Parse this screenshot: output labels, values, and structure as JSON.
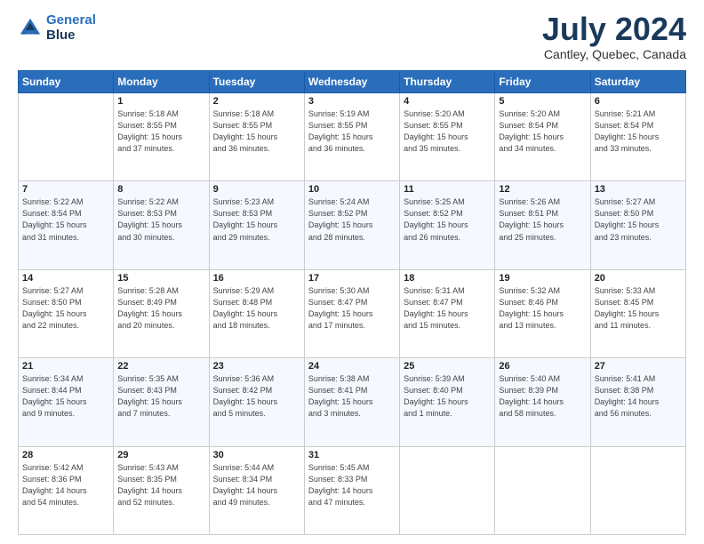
{
  "header": {
    "logo_line1": "General",
    "logo_line2": "Blue",
    "month": "July 2024",
    "location": "Cantley, Quebec, Canada"
  },
  "weekdays": [
    "Sunday",
    "Monday",
    "Tuesday",
    "Wednesday",
    "Thursday",
    "Friday",
    "Saturday"
  ],
  "weeks": [
    [
      {
        "day": "",
        "info": ""
      },
      {
        "day": "1",
        "info": "Sunrise: 5:18 AM\nSunset: 8:55 PM\nDaylight: 15 hours\nand 37 minutes."
      },
      {
        "day": "2",
        "info": "Sunrise: 5:18 AM\nSunset: 8:55 PM\nDaylight: 15 hours\nand 36 minutes."
      },
      {
        "day": "3",
        "info": "Sunrise: 5:19 AM\nSunset: 8:55 PM\nDaylight: 15 hours\nand 36 minutes."
      },
      {
        "day": "4",
        "info": "Sunrise: 5:20 AM\nSunset: 8:55 PM\nDaylight: 15 hours\nand 35 minutes."
      },
      {
        "day": "5",
        "info": "Sunrise: 5:20 AM\nSunset: 8:54 PM\nDaylight: 15 hours\nand 34 minutes."
      },
      {
        "day": "6",
        "info": "Sunrise: 5:21 AM\nSunset: 8:54 PM\nDaylight: 15 hours\nand 33 minutes."
      }
    ],
    [
      {
        "day": "7",
        "info": "Sunrise: 5:22 AM\nSunset: 8:54 PM\nDaylight: 15 hours\nand 31 minutes."
      },
      {
        "day": "8",
        "info": "Sunrise: 5:22 AM\nSunset: 8:53 PM\nDaylight: 15 hours\nand 30 minutes."
      },
      {
        "day": "9",
        "info": "Sunrise: 5:23 AM\nSunset: 8:53 PM\nDaylight: 15 hours\nand 29 minutes."
      },
      {
        "day": "10",
        "info": "Sunrise: 5:24 AM\nSunset: 8:52 PM\nDaylight: 15 hours\nand 28 minutes."
      },
      {
        "day": "11",
        "info": "Sunrise: 5:25 AM\nSunset: 8:52 PM\nDaylight: 15 hours\nand 26 minutes."
      },
      {
        "day": "12",
        "info": "Sunrise: 5:26 AM\nSunset: 8:51 PM\nDaylight: 15 hours\nand 25 minutes."
      },
      {
        "day": "13",
        "info": "Sunrise: 5:27 AM\nSunset: 8:50 PM\nDaylight: 15 hours\nand 23 minutes."
      }
    ],
    [
      {
        "day": "14",
        "info": "Sunrise: 5:27 AM\nSunset: 8:50 PM\nDaylight: 15 hours\nand 22 minutes."
      },
      {
        "day": "15",
        "info": "Sunrise: 5:28 AM\nSunset: 8:49 PM\nDaylight: 15 hours\nand 20 minutes."
      },
      {
        "day": "16",
        "info": "Sunrise: 5:29 AM\nSunset: 8:48 PM\nDaylight: 15 hours\nand 18 minutes."
      },
      {
        "day": "17",
        "info": "Sunrise: 5:30 AM\nSunset: 8:47 PM\nDaylight: 15 hours\nand 17 minutes."
      },
      {
        "day": "18",
        "info": "Sunrise: 5:31 AM\nSunset: 8:47 PM\nDaylight: 15 hours\nand 15 minutes."
      },
      {
        "day": "19",
        "info": "Sunrise: 5:32 AM\nSunset: 8:46 PM\nDaylight: 15 hours\nand 13 minutes."
      },
      {
        "day": "20",
        "info": "Sunrise: 5:33 AM\nSunset: 8:45 PM\nDaylight: 15 hours\nand 11 minutes."
      }
    ],
    [
      {
        "day": "21",
        "info": "Sunrise: 5:34 AM\nSunset: 8:44 PM\nDaylight: 15 hours\nand 9 minutes."
      },
      {
        "day": "22",
        "info": "Sunrise: 5:35 AM\nSunset: 8:43 PM\nDaylight: 15 hours\nand 7 minutes."
      },
      {
        "day": "23",
        "info": "Sunrise: 5:36 AM\nSunset: 8:42 PM\nDaylight: 15 hours\nand 5 minutes."
      },
      {
        "day": "24",
        "info": "Sunrise: 5:38 AM\nSunset: 8:41 PM\nDaylight: 15 hours\nand 3 minutes."
      },
      {
        "day": "25",
        "info": "Sunrise: 5:39 AM\nSunset: 8:40 PM\nDaylight: 15 hours\nand 1 minute."
      },
      {
        "day": "26",
        "info": "Sunrise: 5:40 AM\nSunset: 8:39 PM\nDaylight: 14 hours\nand 58 minutes."
      },
      {
        "day": "27",
        "info": "Sunrise: 5:41 AM\nSunset: 8:38 PM\nDaylight: 14 hours\nand 56 minutes."
      }
    ],
    [
      {
        "day": "28",
        "info": "Sunrise: 5:42 AM\nSunset: 8:36 PM\nDaylight: 14 hours\nand 54 minutes."
      },
      {
        "day": "29",
        "info": "Sunrise: 5:43 AM\nSunset: 8:35 PM\nDaylight: 14 hours\nand 52 minutes."
      },
      {
        "day": "30",
        "info": "Sunrise: 5:44 AM\nSunset: 8:34 PM\nDaylight: 14 hours\nand 49 minutes."
      },
      {
        "day": "31",
        "info": "Sunrise: 5:45 AM\nSunset: 8:33 PM\nDaylight: 14 hours\nand 47 minutes."
      },
      {
        "day": "",
        "info": ""
      },
      {
        "day": "",
        "info": ""
      },
      {
        "day": "",
        "info": ""
      }
    ]
  ]
}
